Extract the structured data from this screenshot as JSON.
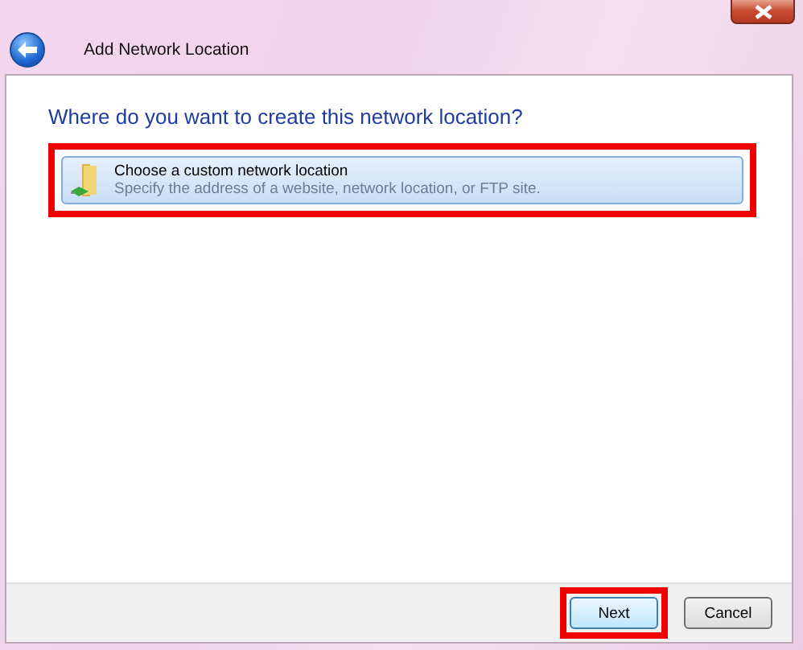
{
  "window": {
    "title": "Add Network Location"
  },
  "heading": "Where do you want to create this network location?",
  "options": [
    {
      "title": "Choose a custom network location",
      "description": "Specify the address of a website, network location, or FTP site.",
      "selected": true,
      "highlighted": true
    }
  ],
  "buttons": [
    {
      "label": "Next",
      "default": true,
      "highlighted": true
    },
    {
      "label": "Cancel",
      "default": false,
      "highlighted": false
    }
  ]
}
